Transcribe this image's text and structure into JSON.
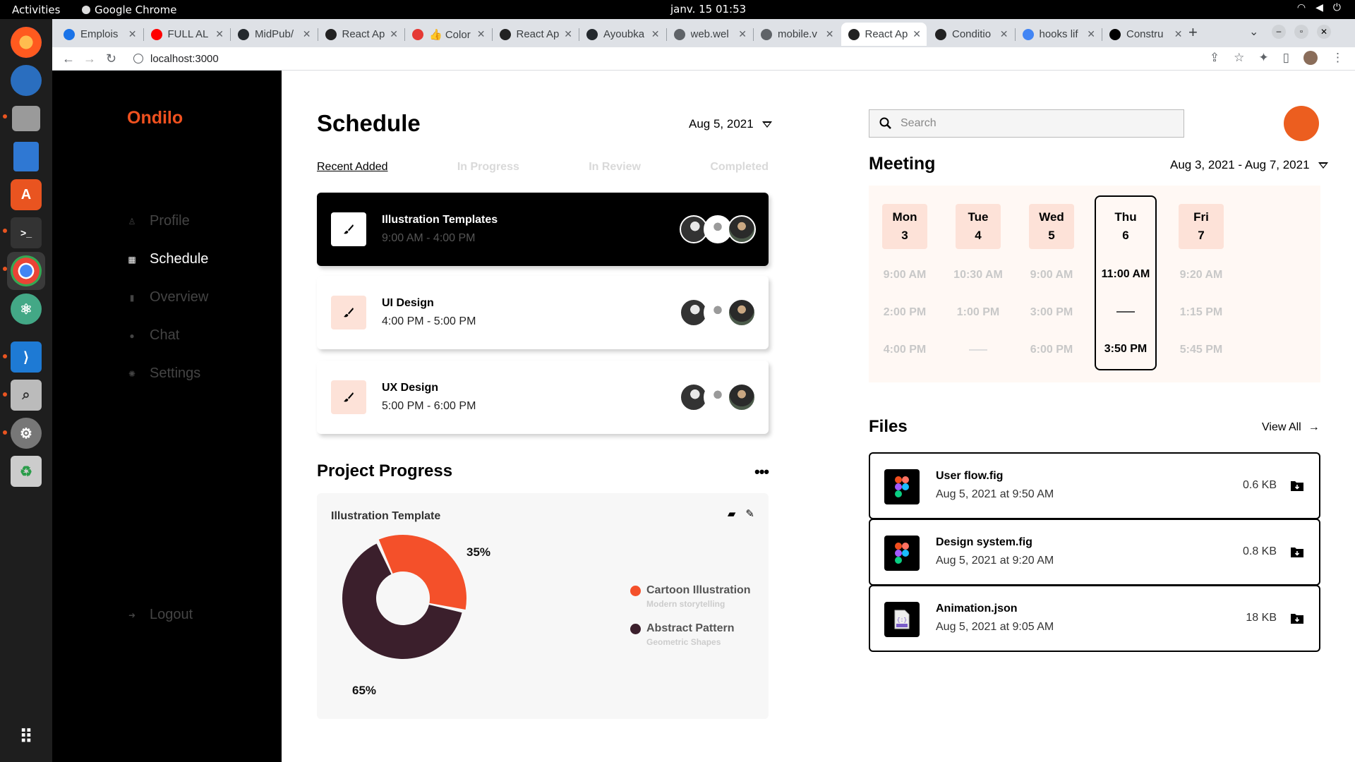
{
  "os": {
    "activities": "Activities",
    "app_name": "Google Chrome",
    "clock": "janv. 15  01:53"
  },
  "browser": {
    "tabs": [
      {
        "label": "Emplois",
        "color": "#1a73e8"
      },
      {
        "label": "FULL AL",
        "color": "#ff0000"
      },
      {
        "label": "MidPub/",
        "color": "#24292e"
      },
      {
        "label": "React Ap",
        "color": "#222"
      },
      {
        "label": "👍 Color",
        "color": "#e53935"
      },
      {
        "label": "React Ap",
        "color": "#222"
      },
      {
        "label": "Ayoubka",
        "color": "#24292e"
      },
      {
        "label": "web.wel",
        "color": "#5f6368"
      },
      {
        "label": "mobile.v",
        "color": "#5f6368"
      },
      {
        "label": "React Ap",
        "color": "#222"
      },
      {
        "label": "Conditio",
        "color": "#222"
      },
      {
        "label": "hooks lif",
        "color": "#4285f4"
      },
      {
        "label": "Constru",
        "color": "#000"
      }
    ],
    "active_tab_index": 9,
    "url": "localhost:3000"
  },
  "sidebar": {
    "brand": "Ondilo",
    "items": [
      {
        "label": "Profile",
        "icon": "user-icon"
      },
      {
        "label": "Schedule",
        "icon": "calendar-icon"
      },
      {
        "label": "Overview",
        "icon": "bar-chart-icon"
      },
      {
        "label": "Chat",
        "icon": "chat-bubble-icon"
      },
      {
        "label": "Settings",
        "icon": "gear-icon"
      }
    ],
    "active_index": 1,
    "logout": "Logout"
  },
  "schedule": {
    "title": "Schedule",
    "date": "Aug 5, 2021",
    "tabs": [
      "Recent Added",
      "In Progress",
      "In Review",
      "Completed"
    ],
    "cards": [
      {
        "title": "Illustration Templates",
        "time": "9:00 AM - 4:00 PM"
      },
      {
        "title": "UI Design",
        "time": "4:00 PM - 5:00 PM"
      },
      {
        "title": "UX Design",
        "time": "5:00 PM - 6:00 PM"
      }
    ]
  },
  "project_progress": {
    "title": "Project Progress",
    "more": "•••",
    "card_title": "Illustration Template",
    "legend": [
      {
        "label": "Cartoon Illustration",
        "sub": "Modern storytelling",
        "color": "#f4502a"
      },
      {
        "label": "Abstract Pattern",
        "sub": "Geometric Shapes",
        "color": "#3b1f2c"
      }
    ]
  },
  "chart_data": {
    "type": "pie",
    "categories": [
      "Cartoon Illustration",
      "Abstract Pattern"
    ],
    "values": [
      35,
      65
    ],
    "labels": [
      "35%",
      "65%"
    ],
    "colors": [
      "#f4502a",
      "#3b1f2c"
    ],
    "title": "Illustration Template"
  },
  "search": {
    "placeholder": "Search"
  },
  "meeting": {
    "title": "Meeting",
    "range": "Aug 3, 2021 - Aug 7, 2021",
    "days": [
      {
        "day": "Mon",
        "num": "3",
        "slots": [
          "9:00 AM",
          "2:00 PM",
          "4:00 PM"
        ]
      },
      {
        "day": "Tue",
        "num": "4",
        "slots": [
          "10:30 AM",
          "1:00 PM",
          ""
        ]
      },
      {
        "day": "Wed",
        "num": "5",
        "slots": [
          "9:00 AM",
          "3:00 PM",
          "6:00 PM"
        ]
      },
      {
        "day": "Thu",
        "num": "6",
        "slots": [
          "11:00 AM",
          "",
          "3:50 PM"
        ]
      },
      {
        "day": "Fri",
        "num": "7",
        "slots": [
          "9:20 AM",
          "1:15 PM",
          "5:45 PM"
        ]
      }
    ],
    "selected_index": 3
  },
  "files": {
    "title": "Files",
    "view_all": "View All",
    "items": [
      {
        "name": "User flow.fig",
        "date": "Aug 5, 2021 at 9:50 AM",
        "size": "0.6 KB",
        "icon": "figma-icon"
      },
      {
        "name": "Design system.fig",
        "date": "Aug 5, 2021 at 9:20 AM",
        "size": "0.8 KB",
        "icon": "figma-icon"
      },
      {
        "name": "Animation.json",
        "date": "Aug 5, 2021 at 9:05 AM",
        "size": "18 KB",
        "icon": "json-file-icon"
      }
    ]
  }
}
